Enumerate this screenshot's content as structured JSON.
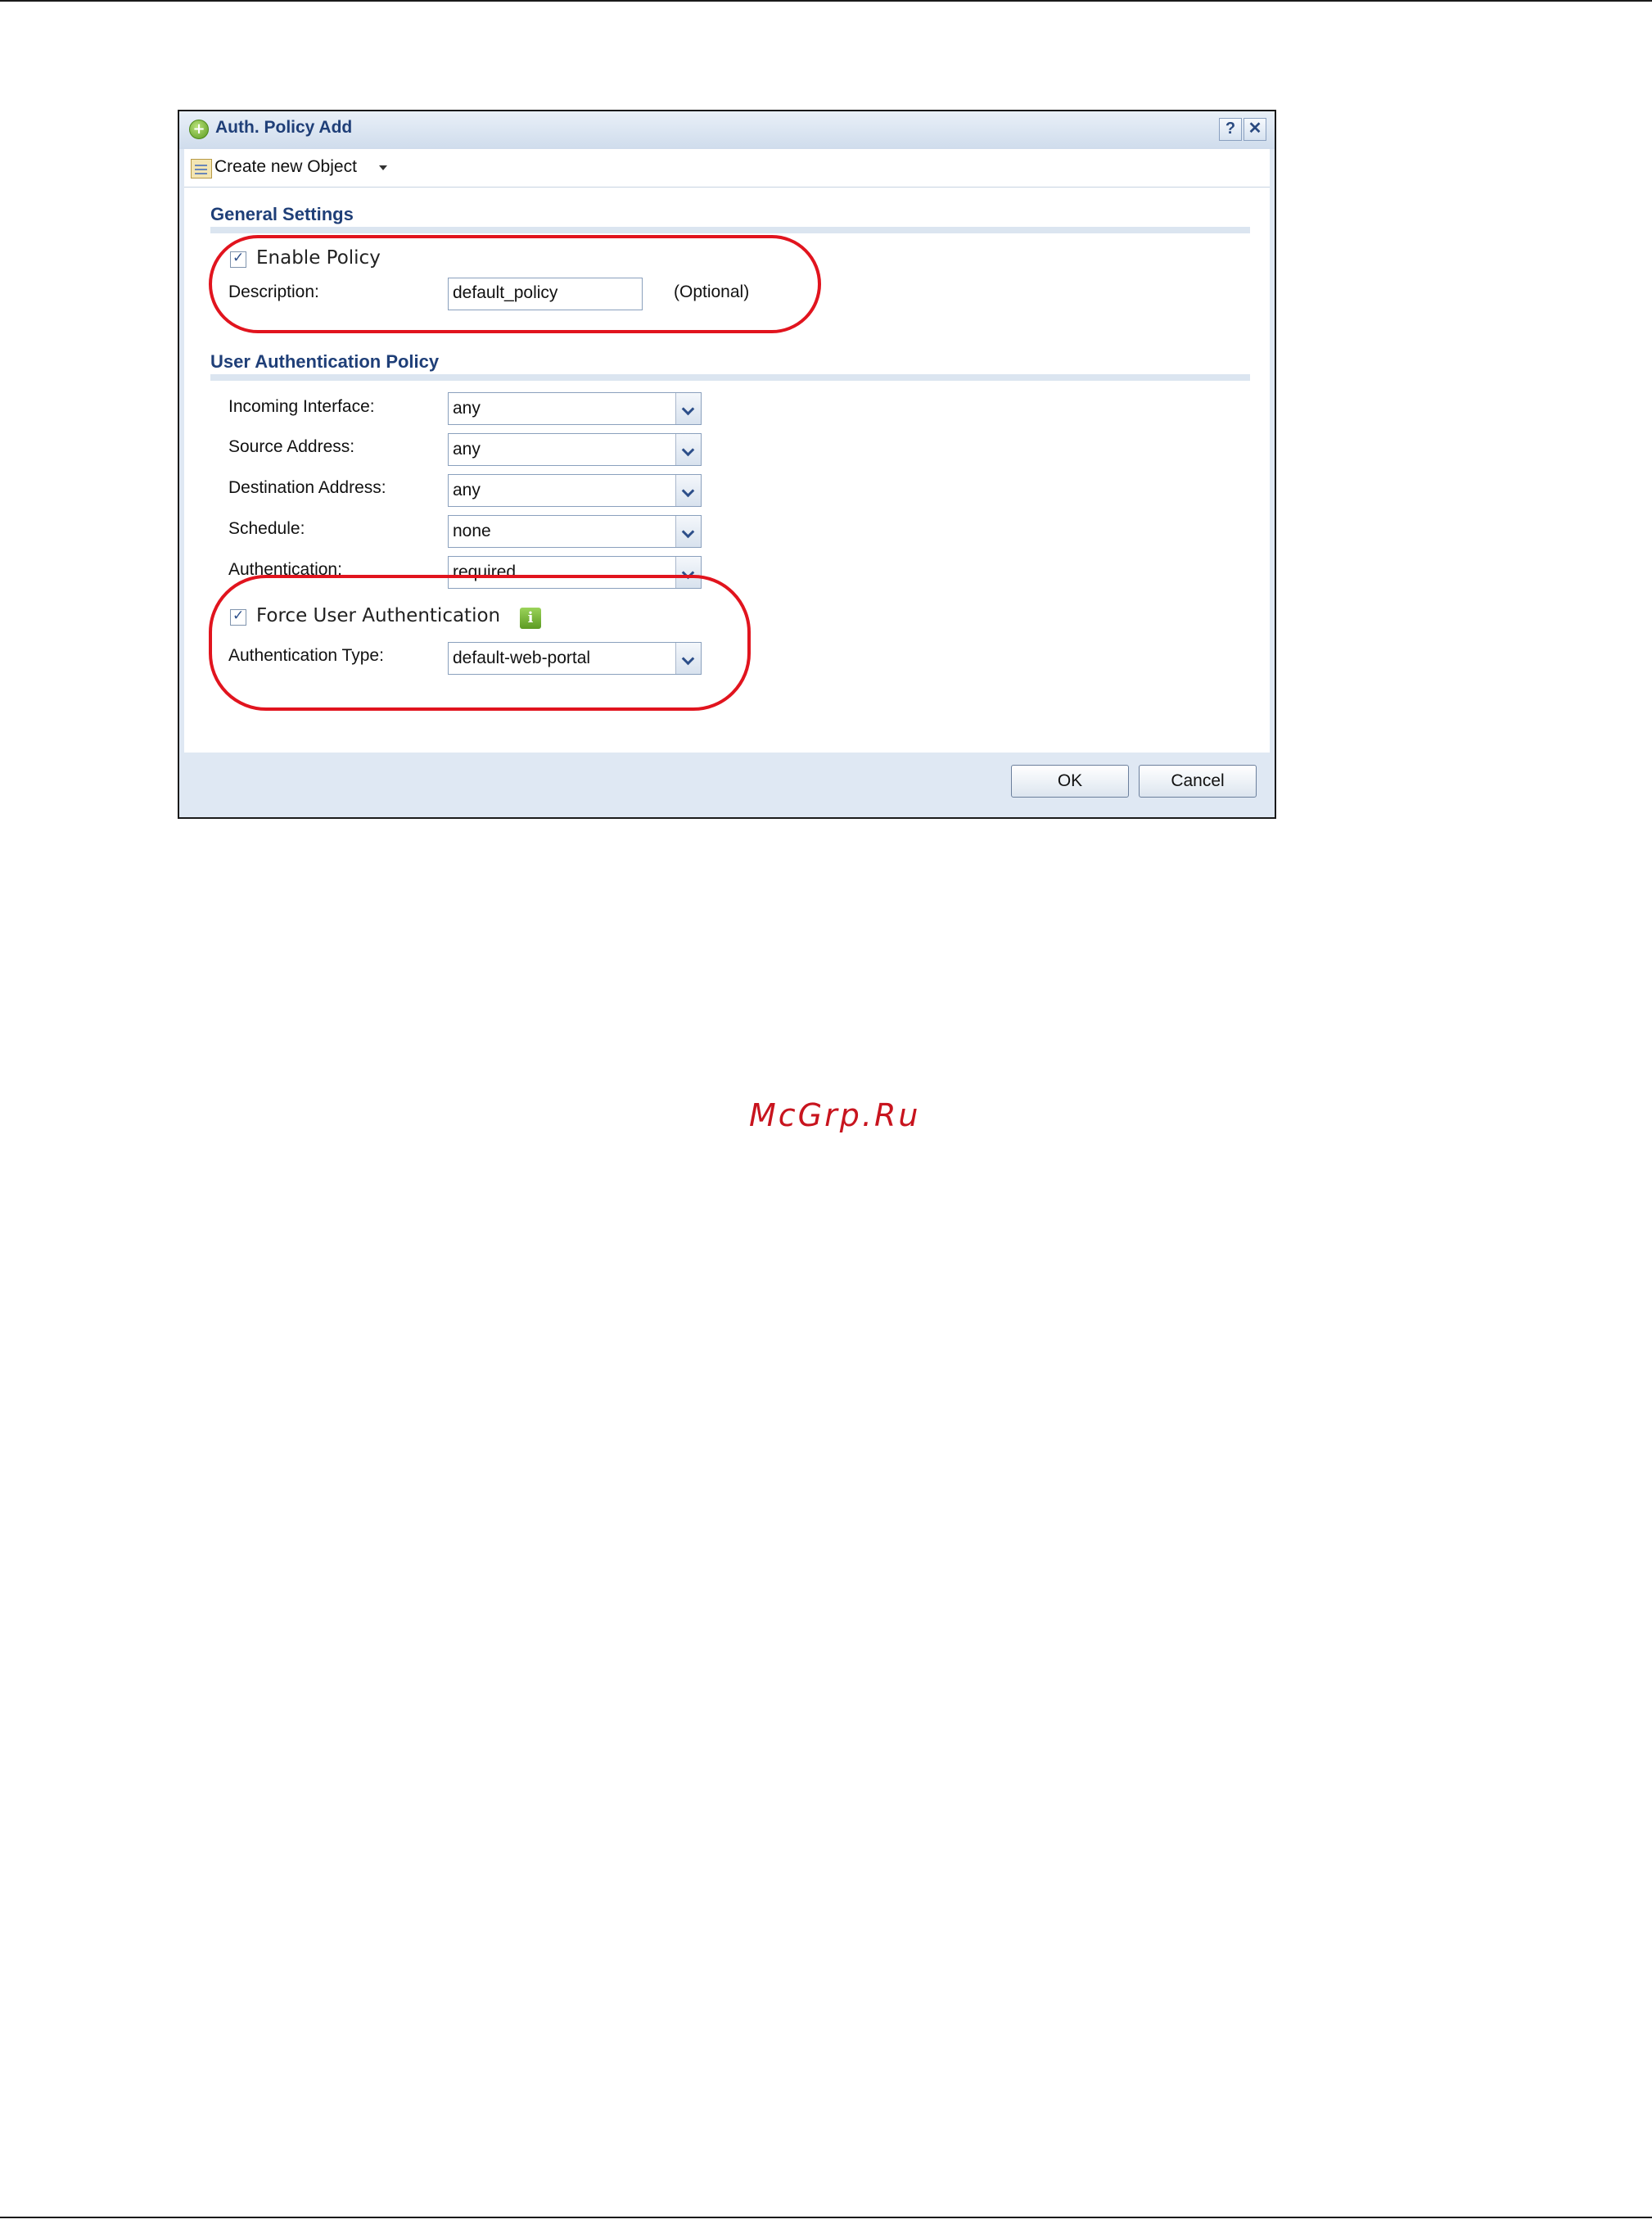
{
  "dialog": {
    "title": "Auth. Policy Add",
    "help_label": "?",
    "close_label": "✕"
  },
  "toolbar": {
    "create_label": "Create new Object"
  },
  "general": {
    "heading": "General Settings",
    "enable_label": "Enable Policy",
    "enable_checked": true,
    "description_label": "Description:",
    "description_value": "default_policy",
    "optional_hint": "(Optional)"
  },
  "user_auth": {
    "heading": "User Authentication Policy",
    "incoming_label": "Incoming Interface:",
    "incoming_value": "any",
    "source_label": "Source Address:",
    "source_value": "any",
    "destination_label": "Destination Address:",
    "destination_value": "any",
    "schedule_label": "Schedule:",
    "schedule_value": "none",
    "authentication_label": "Authentication:",
    "authentication_value": "required",
    "force_label": "Force User Authentication",
    "force_checked": true,
    "info_icon": "i",
    "auth_type_label": "Authentication Type:",
    "auth_type_value": "default-web-portal"
  },
  "buttons": {
    "ok": "OK",
    "cancel": "Cancel"
  },
  "colors": {
    "annotation": "#e1141e",
    "heading": "#1f3f78",
    "watermark": "#c8141e"
  },
  "watermark": "McGrp.Ru"
}
